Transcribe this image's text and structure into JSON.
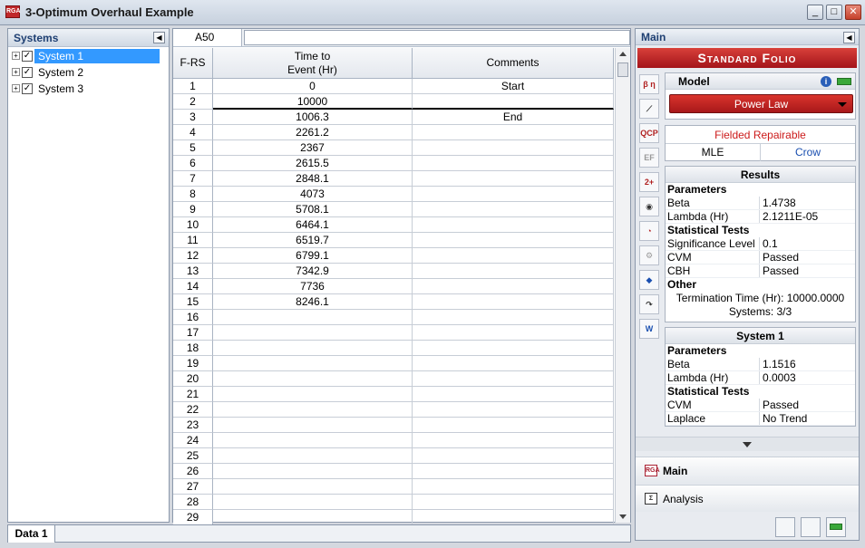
{
  "window": {
    "title": "3-Optimum Overhaul Example"
  },
  "systems_panel": {
    "title": "Systems",
    "items": [
      {
        "label": "System 1",
        "checked": true,
        "selected": true
      },
      {
        "label": "System 2",
        "checked": true,
        "selected": false
      },
      {
        "label": "System 3",
        "checked": true,
        "selected": false
      }
    ]
  },
  "grid": {
    "cell_ref": "A50",
    "formula_value": "",
    "headers": {
      "rs": "F-RS",
      "time": "Time to\nEvent (Hr)",
      "comments": "Comments"
    },
    "rows": [
      {
        "n": "1",
        "time": "0",
        "comment": "Start"
      },
      {
        "n": "2",
        "time": "10000",
        "comment": ""
      },
      {
        "n": "3",
        "time": "1006.3",
        "comment": "End"
      },
      {
        "n": "4",
        "time": "2261.2",
        "comment": ""
      },
      {
        "n": "5",
        "time": "2367",
        "comment": ""
      },
      {
        "n": "6",
        "time": "2615.5",
        "comment": ""
      },
      {
        "n": "7",
        "time": "2848.1",
        "comment": ""
      },
      {
        "n": "8",
        "time": "4073",
        "comment": ""
      },
      {
        "n": "9",
        "time": "5708.1",
        "comment": ""
      },
      {
        "n": "10",
        "time": "6464.1",
        "comment": ""
      },
      {
        "n": "11",
        "time": "6519.7",
        "comment": ""
      },
      {
        "n": "12",
        "time": "6799.1",
        "comment": ""
      },
      {
        "n": "13",
        "time": "7342.9",
        "comment": ""
      },
      {
        "n": "14",
        "time": "7736",
        "comment": ""
      },
      {
        "n": "15",
        "time": "8246.1",
        "comment": ""
      },
      {
        "n": "16",
        "time": "",
        "comment": ""
      },
      {
        "n": "17",
        "time": "",
        "comment": ""
      },
      {
        "n": "18",
        "time": "",
        "comment": ""
      },
      {
        "n": "19",
        "time": "",
        "comment": ""
      },
      {
        "n": "20",
        "time": "",
        "comment": ""
      },
      {
        "n": "21",
        "time": "",
        "comment": ""
      },
      {
        "n": "22",
        "time": "",
        "comment": ""
      },
      {
        "n": "23",
        "time": "",
        "comment": ""
      },
      {
        "n": "24",
        "time": "",
        "comment": ""
      },
      {
        "n": "25",
        "time": "",
        "comment": ""
      },
      {
        "n": "26",
        "time": "",
        "comment": ""
      },
      {
        "n": "27",
        "time": "",
        "comment": ""
      },
      {
        "n": "28",
        "time": "",
        "comment": ""
      },
      {
        "n": "29",
        "time": "",
        "comment": ""
      }
    ]
  },
  "main_panel": {
    "title": "Main",
    "banner": "Standard Folio",
    "model_title": "Model",
    "model_value": "Power Law",
    "data_type": "Fielded Repairable",
    "method": "MLE",
    "submodel": "Crow",
    "results": {
      "title": "Results",
      "parameters_label": "Parameters",
      "beta_label": "Beta",
      "beta": "1.4738",
      "lambda_label": "Lambda (Hr)",
      "lambda": "2.1211E-05",
      "tests_label": "Statistical Tests",
      "sig_label": "Significance Level",
      "sig": "0.1",
      "cvm_label": "CVM",
      "cvm": "Passed",
      "cbh_label": "CBH",
      "cbh": "Passed",
      "other_label": "Other",
      "termination": "Termination Time (Hr): 10000.0000",
      "systems": "Systems: 3/3"
    },
    "system1": {
      "title": "System 1",
      "parameters_label": "Parameters",
      "beta_label": "Beta",
      "beta": "1.1516",
      "lambda_label": "Lambda (Hr)",
      "lambda": "0.0003",
      "tests_label": "Statistical Tests",
      "cvm_label": "CVM",
      "cvm": "Passed",
      "laplace_label": "Laplace",
      "laplace": "No Trend"
    },
    "nav_main": "Main",
    "nav_analysis": "Analysis"
  },
  "bottom": {
    "tab": "Data 1"
  },
  "colors": {
    "accent_red": "#b3161b",
    "selection": "#3399ff",
    "link_blue": "#1a4fb0"
  }
}
